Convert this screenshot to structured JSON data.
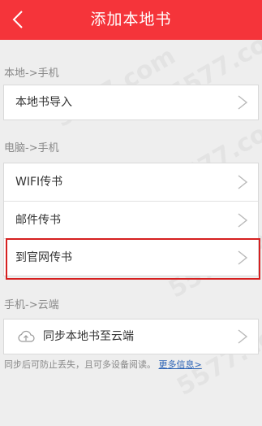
{
  "header": {
    "title": "添加本地书"
  },
  "sections": [
    {
      "label": "本地->手机",
      "items": [
        {
          "label": "本地书导入"
        }
      ]
    },
    {
      "label": "电脑->手机",
      "items": [
        {
          "label": "WIFI传书"
        },
        {
          "label": "邮件传书"
        },
        {
          "label": "到官网传书"
        }
      ]
    },
    {
      "label": "手机->云端",
      "items": [
        {
          "label": "同步本地书至云端"
        }
      ]
    }
  ],
  "footer": {
    "text": "同步后可防止丢失，且可多设备阅读。",
    "link": "更多信息>"
  },
  "watermark": "5577.com",
  "colors": {
    "header_bg": "#f5343a",
    "highlight_border": "#d62020",
    "link": "#2c63b5"
  }
}
